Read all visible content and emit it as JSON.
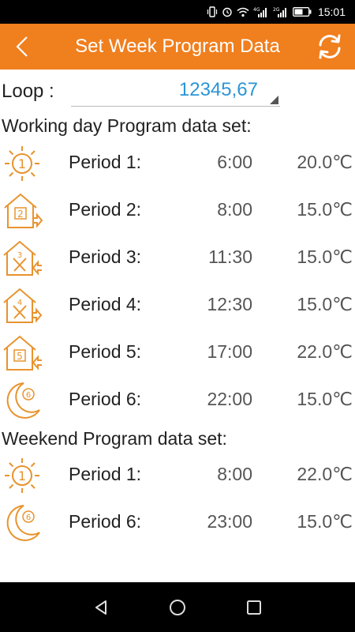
{
  "status_bar": {
    "time": "15:01",
    "icons": [
      "vibrate-icon",
      "alarm-icon",
      "wifi-icon",
      "signal-4g-icon",
      "signal-2g-icon",
      "battery-icon"
    ]
  },
  "app_bar": {
    "title": "Set Week Program Data",
    "back_icon": "chevron-left-icon",
    "refresh_icon": "refresh-icon",
    "background": "#f07f1e"
  },
  "loop": {
    "label": "Loop :",
    "value": "12345,67",
    "value_color": "#2b95d6"
  },
  "working_day": {
    "title": "Working day Program data set:",
    "periods": [
      {
        "icon": "sun-1-icon",
        "number": "1",
        "label": "Period 1:",
        "time": "6:00",
        "temp": "20.0℃"
      },
      {
        "icon": "house-leave-2-icon",
        "number": "2",
        "label": "Period 2:",
        "time": "8:00",
        "temp": "15.0℃"
      },
      {
        "icon": "house-meal-return-3-icon",
        "number": "3",
        "label": "Period 3:",
        "time": "11:30",
        "temp": "15.0℃"
      },
      {
        "icon": "house-meal-leave-4-icon",
        "number": "4",
        "label": "Period 4:",
        "time": "12:30",
        "temp": "15.0℃"
      },
      {
        "icon": "house-return-5-icon",
        "number": "5",
        "label": "Period 5:",
        "time": "17:00",
        "temp": "22.0℃"
      },
      {
        "icon": "moon-6-icon",
        "number": "6",
        "label": "Period 6:",
        "time": "22:00",
        "temp": "15.0℃"
      }
    ]
  },
  "weekend": {
    "title": "Weekend Program data set:",
    "periods": [
      {
        "icon": "sun-1-icon",
        "number": "1",
        "label": "Period 1:",
        "time": "8:00",
        "temp": "22.0℃"
      },
      {
        "icon": "moon-6-icon",
        "number": "6",
        "label": "Period 6:",
        "time": "23:00",
        "temp": "15.0℃"
      }
    ]
  },
  "nav_bar": {
    "buttons": [
      "back-triangle-icon",
      "home-circle-icon",
      "recents-square-icon"
    ]
  },
  "colors": {
    "accent": "#f07f1e",
    "icon_stroke": "#e8932e",
    "loop_value": "#2b95d6"
  }
}
